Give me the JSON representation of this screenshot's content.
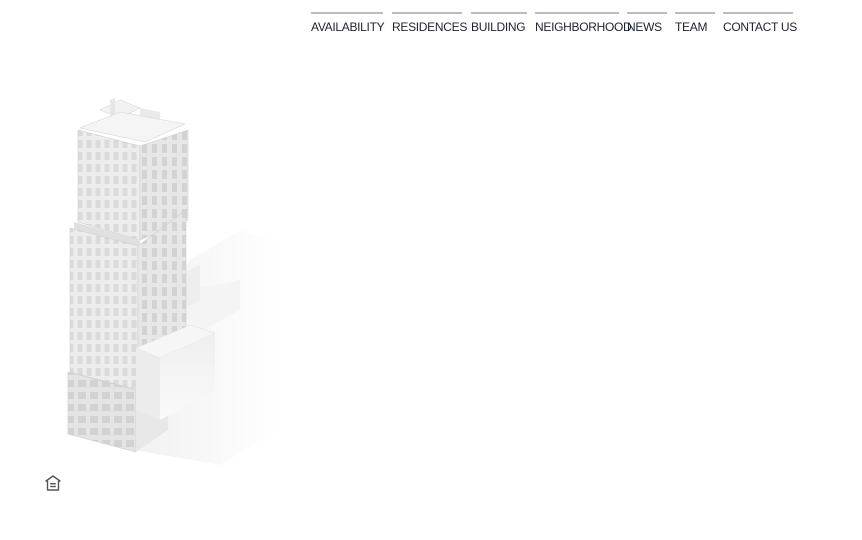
{
  "nav": {
    "items": [
      {
        "label": "AVAILABILITY",
        "name": "nav-item-availability"
      },
      {
        "label": "RESIDENCES",
        "name": "nav-item-residences"
      },
      {
        "label": "BUILDING",
        "name": "nav-item-building"
      },
      {
        "label": "NEIGHBORHOOD",
        "name": "nav-item-neighborhood"
      },
      {
        "label": "NEWS",
        "name": "nav-item-news"
      },
      {
        "label": "TEAM",
        "name": "nav-item-team"
      },
      {
        "label": "CONTACT US",
        "name": "nav-item-contact-us"
      }
    ]
  },
  "hero": {
    "image": "building-rendering",
    "image_tone": "white-gray"
  },
  "footer": {
    "icon": "equal-housing-opportunity-icon"
  },
  "colors": {
    "nav_text": "#1c2233",
    "nav_rule": "#b9bcc2",
    "background": "#ffffff"
  }
}
